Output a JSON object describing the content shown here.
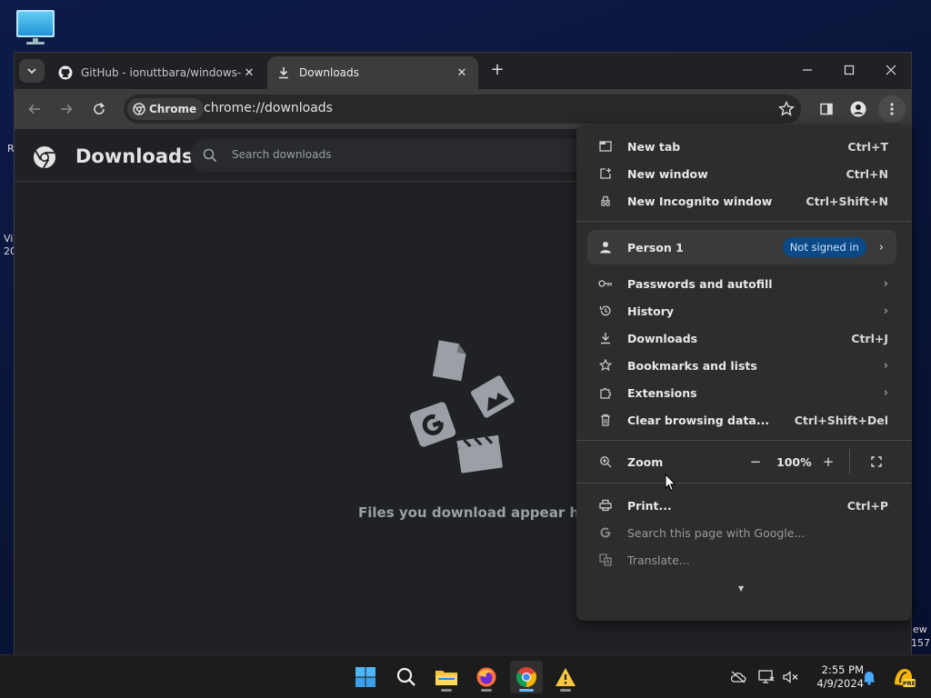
{
  "desktop": {
    "edge_text_1": "R",
    "edge_text_2": "Vi",
    "edge_text_3": "20",
    "edge_text_4": "ew",
    "edge_text_5": "157"
  },
  "tabs": [
    {
      "title": "GitHub - ionuttbara/windows-d",
      "icon": "github-icon"
    },
    {
      "title": "Downloads",
      "icon": "download-icon"
    }
  ],
  "toolbar": {
    "chip_label": "Chrome",
    "url": "chrome://downloads"
  },
  "page": {
    "title": "Downloads",
    "search_placeholder": "Search downloads",
    "empty_text": "Files you download appear here"
  },
  "menu": {
    "new_tab": {
      "label": "New tab",
      "shortcut": "Ctrl+T"
    },
    "new_window": {
      "label": "New window",
      "shortcut": "Ctrl+N"
    },
    "new_incognito": {
      "label": "New Incognito window",
      "shortcut": "Ctrl+Shift+N"
    },
    "person": {
      "label": "Person 1",
      "badge": "Not signed in"
    },
    "passwords": {
      "label": "Passwords and autofill"
    },
    "history": {
      "label": "History"
    },
    "downloads": {
      "label": "Downloads",
      "shortcut": "Ctrl+J"
    },
    "bookmarks": {
      "label": "Bookmarks and lists"
    },
    "extensions": {
      "label": "Extensions"
    },
    "clear": {
      "label": "Clear browsing data...",
      "shortcut": "Ctrl+Shift+Del"
    },
    "zoom": {
      "label": "Zoom",
      "value": "100%"
    },
    "print": {
      "label": "Print...",
      "shortcut": "Ctrl+P"
    },
    "search_google": {
      "label": "Search this page with Google..."
    },
    "translate": {
      "label": "Translate..."
    }
  },
  "taskbar": {
    "time": "2:55 PM",
    "date": "4/9/2024"
  },
  "colors": {
    "accent_badge": "#0b4a86",
    "menu_bg": "#2d2d2d",
    "page_bg": "#202124"
  }
}
